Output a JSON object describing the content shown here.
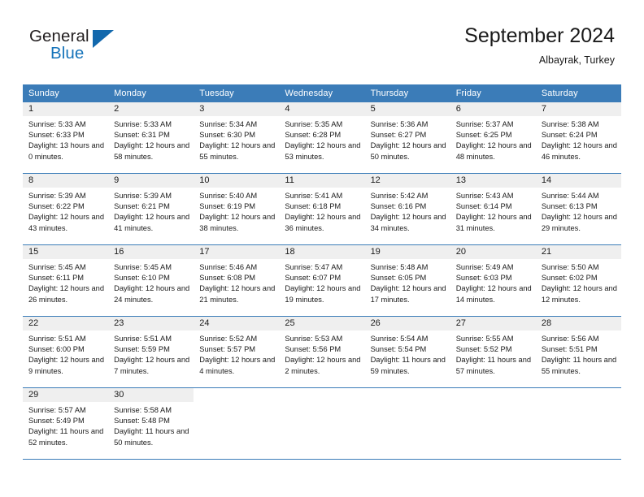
{
  "brand": {
    "name_part1": "General",
    "name_part2": "Blue",
    "accent_color": "#1268ad"
  },
  "header": {
    "title": "September 2024",
    "subtitle": "Albayrak, Turkey"
  },
  "theme": {
    "header_blue": "#3b7cb8",
    "day_band_gray": "#efefef"
  },
  "weekdays": [
    "Sunday",
    "Monday",
    "Tuesday",
    "Wednesday",
    "Thursday",
    "Friday",
    "Saturday"
  ],
  "weeks": [
    [
      {
        "day": "1",
        "sunrise": "Sunrise: 5:33 AM",
        "sunset": "Sunset: 6:33 PM",
        "daylight": "Daylight: 13 hours and 0 minutes."
      },
      {
        "day": "2",
        "sunrise": "Sunrise: 5:33 AM",
        "sunset": "Sunset: 6:31 PM",
        "daylight": "Daylight: 12 hours and 58 minutes."
      },
      {
        "day": "3",
        "sunrise": "Sunrise: 5:34 AM",
        "sunset": "Sunset: 6:30 PM",
        "daylight": "Daylight: 12 hours and 55 minutes."
      },
      {
        "day": "4",
        "sunrise": "Sunrise: 5:35 AM",
        "sunset": "Sunset: 6:28 PM",
        "daylight": "Daylight: 12 hours and 53 minutes."
      },
      {
        "day": "5",
        "sunrise": "Sunrise: 5:36 AM",
        "sunset": "Sunset: 6:27 PM",
        "daylight": "Daylight: 12 hours and 50 minutes."
      },
      {
        "day": "6",
        "sunrise": "Sunrise: 5:37 AM",
        "sunset": "Sunset: 6:25 PM",
        "daylight": "Daylight: 12 hours and 48 minutes."
      },
      {
        "day": "7",
        "sunrise": "Sunrise: 5:38 AM",
        "sunset": "Sunset: 6:24 PM",
        "daylight": "Daylight: 12 hours and 46 minutes."
      }
    ],
    [
      {
        "day": "8",
        "sunrise": "Sunrise: 5:39 AM",
        "sunset": "Sunset: 6:22 PM",
        "daylight": "Daylight: 12 hours and 43 minutes."
      },
      {
        "day": "9",
        "sunrise": "Sunrise: 5:39 AM",
        "sunset": "Sunset: 6:21 PM",
        "daylight": "Daylight: 12 hours and 41 minutes."
      },
      {
        "day": "10",
        "sunrise": "Sunrise: 5:40 AM",
        "sunset": "Sunset: 6:19 PM",
        "daylight": "Daylight: 12 hours and 38 minutes."
      },
      {
        "day": "11",
        "sunrise": "Sunrise: 5:41 AM",
        "sunset": "Sunset: 6:18 PM",
        "daylight": "Daylight: 12 hours and 36 minutes."
      },
      {
        "day": "12",
        "sunrise": "Sunrise: 5:42 AM",
        "sunset": "Sunset: 6:16 PM",
        "daylight": "Daylight: 12 hours and 34 minutes."
      },
      {
        "day": "13",
        "sunrise": "Sunrise: 5:43 AM",
        "sunset": "Sunset: 6:14 PM",
        "daylight": "Daylight: 12 hours and 31 minutes."
      },
      {
        "day": "14",
        "sunrise": "Sunrise: 5:44 AM",
        "sunset": "Sunset: 6:13 PM",
        "daylight": "Daylight: 12 hours and 29 minutes."
      }
    ],
    [
      {
        "day": "15",
        "sunrise": "Sunrise: 5:45 AM",
        "sunset": "Sunset: 6:11 PM",
        "daylight": "Daylight: 12 hours and 26 minutes."
      },
      {
        "day": "16",
        "sunrise": "Sunrise: 5:45 AM",
        "sunset": "Sunset: 6:10 PM",
        "daylight": "Daylight: 12 hours and 24 minutes."
      },
      {
        "day": "17",
        "sunrise": "Sunrise: 5:46 AM",
        "sunset": "Sunset: 6:08 PM",
        "daylight": "Daylight: 12 hours and 21 minutes."
      },
      {
        "day": "18",
        "sunrise": "Sunrise: 5:47 AM",
        "sunset": "Sunset: 6:07 PM",
        "daylight": "Daylight: 12 hours and 19 minutes."
      },
      {
        "day": "19",
        "sunrise": "Sunrise: 5:48 AM",
        "sunset": "Sunset: 6:05 PM",
        "daylight": "Daylight: 12 hours and 17 minutes."
      },
      {
        "day": "20",
        "sunrise": "Sunrise: 5:49 AM",
        "sunset": "Sunset: 6:03 PM",
        "daylight": "Daylight: 12 hours and 14 minutes."
      },
      {
        "day": "21",
        "sunrise": "Sunrise: 5:50 AM",
        "sunset": "Sunset: 6:02 PM",
        "daylight": "Daylight: 12 hours and 12 minutes."
      }
    ],
    [
      {
        "day": "22",
        "sunrise": "Sunrise: 5:51 AM",
        "sunset": "Sunset: 6:00 PM",
        "daylight": "Daylight: 12 hours and 9 minutes."
      },
      {
        "day": "23",
        "sunrise": "Sunrise: 5:51 AM",
        "sunset": "Sunset: 5:59 PM",
        "daylight": "Daylight: 12 hours and 7 minutes."
      },
      {
        "day": "24",
        "sunrise": "Sunrise: 5:52 AM",
        "sunset": "Sunset: 5:57 PM",
        "daylight": "Daylight: 12 hours and 4 minutes."
      },
      {
        "day": "25",
        "sunrise": "Sunrise: 5:53 AM",
        "sunset": "Sunset: 5:56 PM",
        "daylight": "Daylight: 12 hours and 2 minutes."
      },
      {
        "day": "26",
        "sunrise": "Sunrise: 5:54 AM",
        "sunset": "Sunset: 5:54 PM",
        "daylight": "Daylight: 11 hours and 59 minutes."
      },
      {
        "day": "27",
        "sunrise": "Sunrise: 5:55 AM",
        "sunset": "Sunset: 5:52 PM",
        "daylight": "Daylight: 11 hours and 57 minutes."
      },
      {
        "day": "28",
        "sunrise": "Sunrise: 5:56 AM",
        "sunset": "Sunset: 5:51 PM",
        "daylight": "Daylight: 11 hours and 55 minutes."
      }
    ],
    [
      {
        "day": "29",
        "sunrise": "Sunrise: 5:57 AM",
        "sunset": "Sunset: 5:49 PM",
        "daylight": "Daylight: 11 hours and 52 minutes."
      },
      {
        "day": "30",
        "sunrise": "Sunrise: 5:58 AM",
        "sunset": "Sunset: 5:48 PM",
        "daylight": "Daylight: 11 hours and 50 minutes."
      },
      {
        "day": "",
        "sunrise": "",
        "sunset": "",
        "daylight": ""
      },
      {
        "day": "",
        "sunrise": "",
        "sunset": "",
        "daylight": ""
      },
      {
        "day": "",
        "sunrise": "",
        "sunset": "",
        "daylight": ""
      },
      {
        "day": "",
        "sunrise": "",
        "sunset": "",
        "daylight": ""
      },
      {
        "day": "",
        "sunrise": "",
        "sunset": "",
        "daylight": ""
      }
    ]
  ]
}
